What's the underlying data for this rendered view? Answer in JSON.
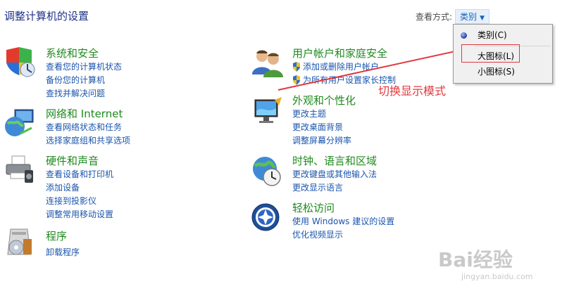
{
  "title": "调整计算机的设置",
  "view_by": {
    "label": "查看方式:",
    "current": "类别"
  },
  "dropdown": {
    "options": [
      {
        "label": "类别(C)",
        "selected": true
      },
      {
        "label": "大图标(L)",
        "selected": false
      },
      {
        "label": "小图标(S)",
        "selected": false
      }
    ]
  },
  "annotation": {
    "text": "切换显示模式",
    "color": "#e0383d"
  },
  "categories": [
    {
      "title": "系统和安全",
      "icon": "shield-system-icon",
      "links": [
        "查看您的计算机状态",
        "备份您的计算机",
        "查找并解决问题"
      ]
    },
    {
      "title": "网络和 Internet",
      "icon": "network-globe-icon",
      "links": [
        "查看网络状态和任务",
        "选择家庭组和共享选项"
      ]
    },
    {
      "title": "硬件和声音",
      "icon": "printer-icon",
      "links": [
        "查看设备和打印机",
        "添加设备",
        "连接到投影仪",
        "调整常用移动设置"
      ]
    },
    {
      "title": "程序",
      "icon": "programs-box-icon",
      "links": [
        "卸载程序"
      ]
    },
    {
      "title": "用户帐户和家庭安全",
      "icon": "users-icon",
      "links": [
        "添加或删除用户帐户",
        "为所有用户设置家长控制"
      ]
    },
    {
      "title": "外观和个性化",
      "icon": "monitor-paint-icon",
      "links": [
        "更改主题",
        "更改桌面背景",
        "调整屏幕分辨率"
      ]
    },
    {
      "title": "时钟、语言和区域",
      "icon": "clock-globe-icon",
      "links": [
        "更改键盘或其他输入法",
        "更改显示语言"
      ]
    },
    {
      "title": "轻松访问",
      "icon": "ease-of-access-icon",
      "links": [
        "使用 Windows 建议的设置",
        "优化视频显示"
      ]
    }
  ],
  "watermark": {
    "brand": "Bai经验",
    "url": "jingyan.baidu.com"
  }
}
